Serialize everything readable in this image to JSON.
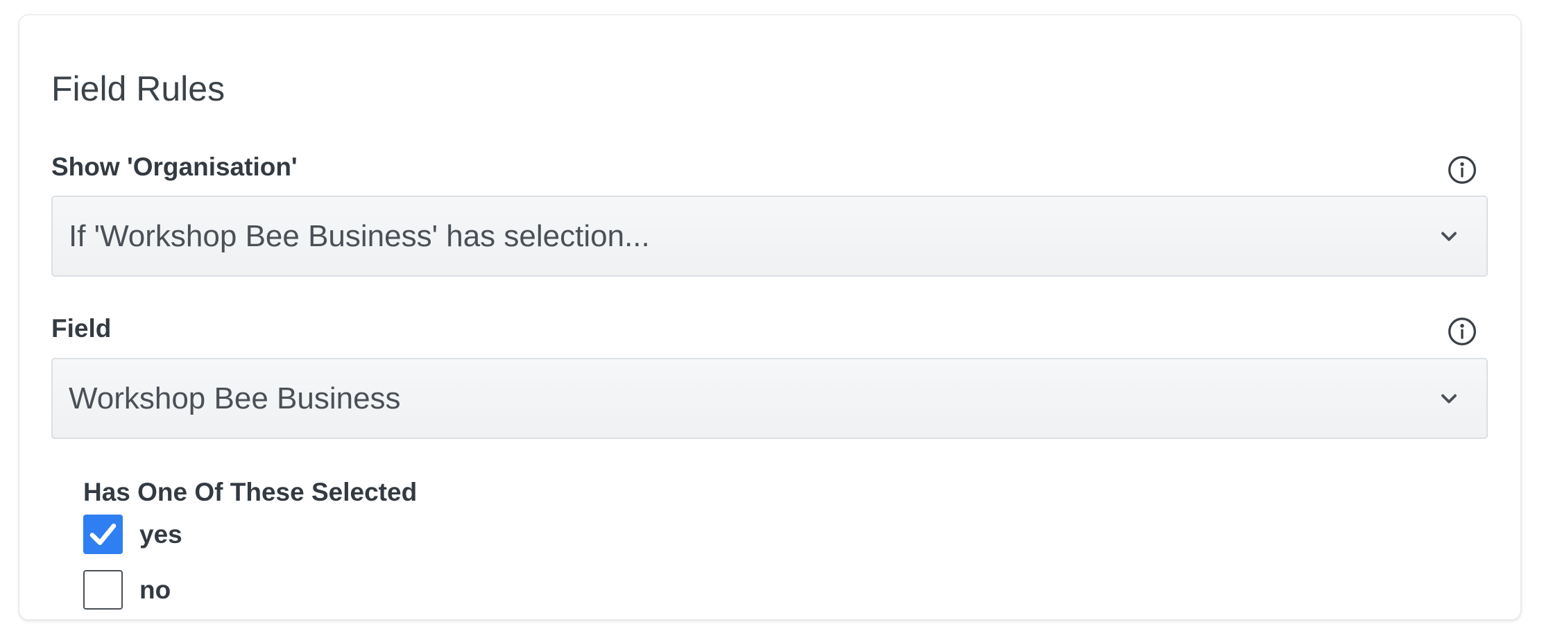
{
  "card": {
    "title": "Field Rules"
  },
  "show_rule": {
    "label": "Show 'Organisation'",
    "info_icon": "info-circle-icon",
    "selected_value": "If 'Workshop Bee Business' has selection..."
  },
  "field_rule": {
    "label": "Field",
    "info_icon": "info-circle-icon",
    "selected_value": "Workshop Bee Business"
  },
  "selection_group": {
    "label": "Has One Of These Selected",
    "options": [
      {
        "label": "yes",
        "checked": true
      },
      {
        "label": "no",
        "checked": false
      }
    ]
  },
  "colors": {
    "accent": "#2f7ff2",
    "text": "#333a41",
    "select_background": "#f1f3f5",
    "select_border": "#dcdfe3"
  }
}
